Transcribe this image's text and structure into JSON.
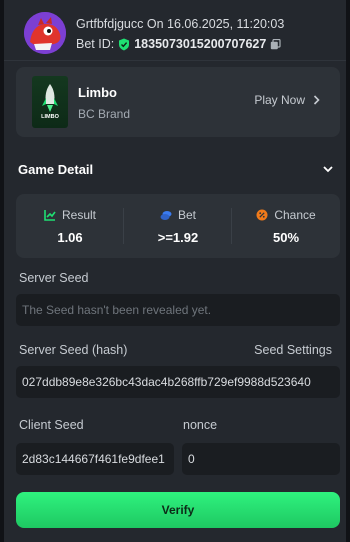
{
  "header": {
    "username": "Grtfbfdjgucc",
    "on_label": "On",
    "datetime": "16.06.2025, 11:20:03",
    "bet_id_label": "Bet ID:",
    "bet_id": "1835073015200707627"
  },
  "game": {
    "name": "Limbo",
    "brand": "BC Brand",
    "thumb_text": "LIMBO",
    "play_label": "Play Now"
  },
  "game_detail": {
    "title": "Game Detail",
    "stats": [
      {
        "label": "Result",
        "value": "1.06",
        "icon": "chart-up-icon",
        "color": "#1fe073"
      },
      {
        "label": "Bet",
        "value": ">=1.92",
        "icon": "coins-icon",
        "color": "#3a7bf0"
      },
      {
        "label": "Chance",
        "value": "50%",
        "icon": "percent-icon",
        "color": "#f07a1a"
      }
    ]
  },
  "server_seed": {
    "label": "Server Seed",
    "placeholder": "The Seed hasn't been revealed yet."
  },
  "server_seed_hash": {
    "label": "Server Seed (hash)",
    "settings_label": "Seed Settings",
    "value": "027ddb89e8e326bc43dac4b268ffb729ef9988d523640"
  },
  "client_seed": {
    "label": "Client Seed",
    "value": "2d83c144667f461fe9dfee1"
  },
  "nonce": {
    "label": "nonce",
    "value": "0"
  },
  "verify_label": "Verify",
  "colors": {
    "accent_green": "#1fe073",
    "panel": "#24282e",
    "card": "#2d3238",
    "input": "#1a1d21"
  }
}
